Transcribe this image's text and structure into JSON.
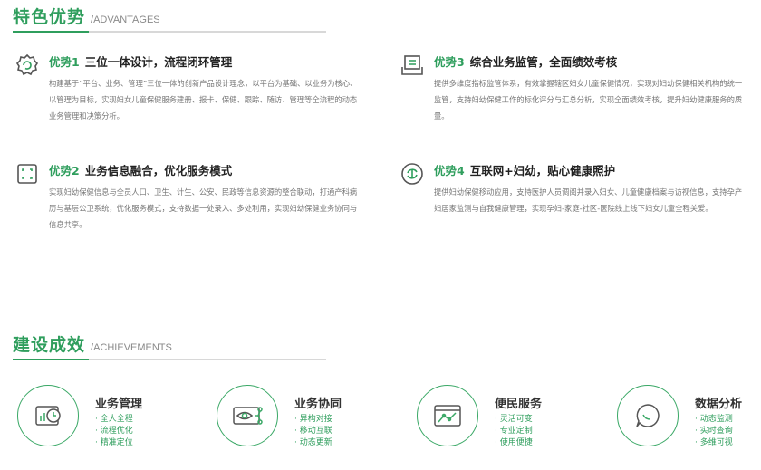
{
  "advantages_header": {
    "title": "特色优势",
    "subtitle": "/ADVANTAGES"
  },
  "advantages": [
    {
      "tag": "优势1",
      "title": "三位一体设计，流程闭环管理",
      "icon": "gear-refresh-icon",
      "text": "构建基于“平台、业务、管理”三位一体的创新产品设计理念，以平台为基础、以业务为核心、以管理为目标，实现妇女儿童保健服务建册、报卡、保健、跟踪、随访、管理等全流程的动态业务管理和决策分析。"
    },
    {
      "tag": "优势3",
      "title": "综合业务监管，全面绩效考核",
      "icon": "document-tray-icon",
      "text": "提供多维度指标监管体系，有效掌握辖区妇女儿童保健情况，实现对妇幼保健相关机构的统一监管，支持妇幼保健工作的标化评分与汇总分析，实现全面绩效考核，提升妇幼健康服务的质量。"
    },
    {
      "tag": "优势2",
      "title": "业务信息融合，优化服务模式",
      "icon": "scan-frame-icon",
      "text": "实现妇幼保健信息与全员人口、卫生、计生、公安、民政等信息资源的整合联动，打通产科病历与基层公卫系统，优化服务模式，支持数据一处录入、多处利用，实现妇幼保健业务协同与信息共享。"
    },
    {
      "tag": "优势4",
      "title": "互联网+妇幼，贴心健康照护",
      "icon": "refresh-dollar-icon",
      "text": "提供妇幼保健移动应用，支持医护人员调阅并录入妇女、儿童健康档案与访视信息，支持孕产妇居家监测与自我健康管理，实现孕妇-家庭-社区-医院线上线下妇女儿童全程关爱。"
    }
  ],
  "achievements_header": {
    "title": "建设成效",
    "subtitle": "/ACHIEVEMENTS"
  },
  "achievements": [
    {
      "name": "业务管理",
      "icon": "chart-clock-icon",
      "items": [
        "全人全程",
        "流程优化",
        "精准定位"
      ]
    },
    {
      "name": "业务协同",
      "icon": "eye-network-icon",
      "items": [
        "异构对接",
        "移动互联",
        "动态更新"
      ]
    },
    {
      "name": "便民服务",
      "icon": "line-chart-screen-icon",
      "items": [
        "灵活可变",
        "专业定制",
        "使用便捷"
      ]
    },
    {
      "name": "数据分析",
      "icon": "chat-bubble-icon",
      "items": [
        "动态监测",
        "实时查询",
        "多维可视"
      ]
    }
  ],
  "colors": {
    "accent": "#2f9e5d",
    "text": "#222222",
    "muted": "#777777",
    "rule": "#d8d8d8"
  }
}
